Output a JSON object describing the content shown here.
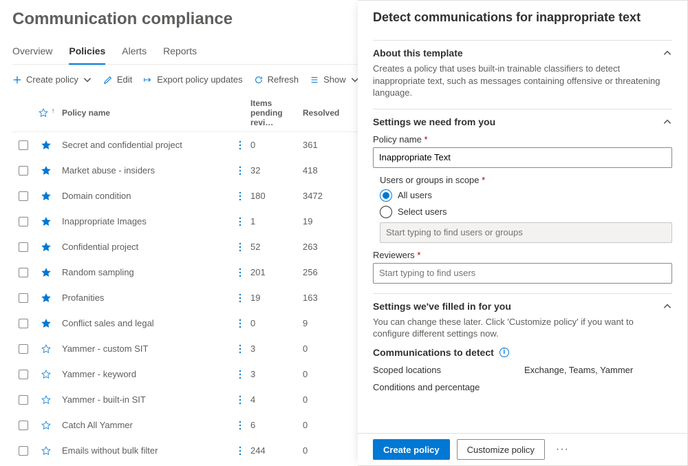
{
  "page_title": "Communication compliance",
  "tabs": [
    "Overview",
    "Policies",
    "Alerts",
    "Reports"
  ],
  "active_tab": 1,
  "toolbar": {
    "create": "Create policy",
    "edit": "Edit",
    "export": "Export policy updates",
    "refresh": "Refresh",
    "show": "Show"
  },
  "table": {
    "headers": {
      "name": "Policy name",
      "pending": "Items pending revi…",
      "resolved": "Resolved"
    },
    "rows": [
      {
        "name": "Secret and confidential project",
        "pending": "0",
        "resolved": "361",
        "starred": true
      },
      {
        "name": "Market abuse - insiders",
        "pending": "32",
        "resolved": "418",
        "starred": true
      },
      {
        "name": "Domain condition",
        "pending": "180",
        "resolved": "3472",
        "starred": true
      },
      {
        "name": "Inappropriate Images",
        "pending": "1",
        "resolved": "19",
        "starred": true
      },
      {
        "name": "Confidential project",
        "pending": "52",
        "resolved": "263",
        "starred": true
      },
      {
        "name": "Random sampling",
        "pending": "201",
        "resolved": "256",
        "starred": true
      },
      {
        "name": "Profanities",
        "pending": "19",
        "resolved": "163",
        "starred": true
      },
      {
        "name": "Conflict sales and legal",
        "pending": "0",
        "resolved": "9",
        "starred": true
      },
      {
        "name": "Yammer - custom SIT",
        "pending": "3",
        "resolved": "0",
        "starred": false
      },
      {
        "name": "Yammer - keyword",
        "pending": "3",
        "resolved": "0",
        "starred": false
      },
      {
        "name": "Yammer - built-in SIT",
        "pending": "4",
        "resolved": "0",
        "starred": false
      },
      {
        "name": "Catch All Yammer",
        "pending": "6",
        "resolved": "0",
        "starred": false
      },
      {
        "name": "Emails without bulk filter",
        "pending": "244",
        "resolved": "0",
        "starred": false
      }
    ]
  },
  "panel": {
    "title": "Detect communications for inappropriate text",
    "sections": {
      "about": {
        "title": "About this template",
        "desc": "Creates a policy that uses built-in trainable classifiers to detect inappropriate text, such as messages containing offensive or threatening language."
      },
      "settings_need": {
        "title": "Settings we need from you",
        "policy_name_label": "Policy name",
        "policy_name_value": "Inappropriate Text",
        "scope_label": "Users or groups in scope",
        "scope_options": [
          "All users",
          "Select users"
        ],
        "scope_selected": 0,
        "scope_placeholder": "Start typing to find users or groups",
        "reviewers_label": "Reviewers",
        "reviewers_placeholder": "Start typing to find users"
      },
      "settings_filled": {
        "title": "Settings we've filled in for you",
        "desc": "You can change these later. Click 'Customize policy' if you want to configure different settings now.",
        "comm_title": "Communications to detect",
        "scoped_label": "Scoped locations",
        "scoped_value": "Exchange, Teams, Yammer",
        "conditions_label": "Conditions and percentage"
      }
    },
    "footer": {
      "create": "Create policy",
      "customize": "Customize policy"
    }
  }
}
